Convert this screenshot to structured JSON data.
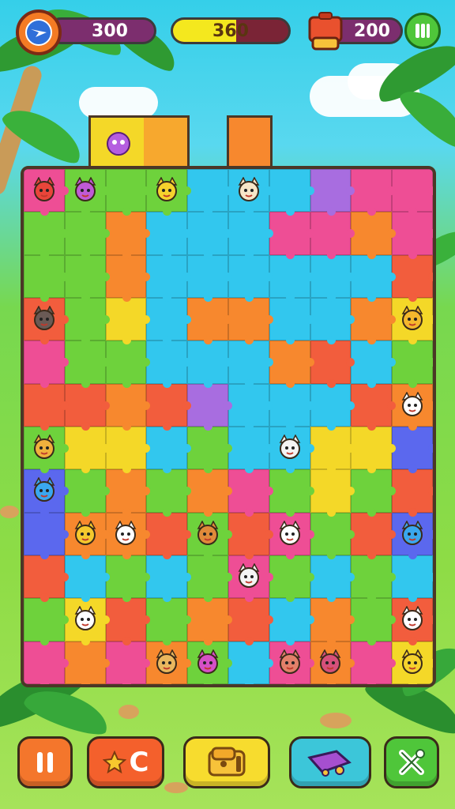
{
  "hud": {
    "coins": "300",
    "progress_value": "360",
    "progress_fraction": 0.55,
    "gems": "200"
  },
  "icons": {
    "coin_badge": "bird-emblem-icon",
    "gems_badge": "toolbox-icon",
    "menu_button": "pause-bars-icon"
  },
  "board": {
    "columns": 10,
    "rows": 12,
    "palette": {
      "o": "#f7882e",
      "y": "#f4d828",
      "g": "#6ed23c",
      "c": "#32c7ee",
      "p": "#ee4e95",
      "r": "#f25d3d",
      "v": "#a86de0",
      "b": "#5b68ee",
      "k": "#f0b13d"
    },
    "rows_layout": [
      "pgggcccvpp",
      "ggocccppop",
      "ggoccccccr",
      "rgycooccoy",
      "pggcccorcg",
      "rrorvcccro",
      "gyycgccyyb",
      "bgogopgygr",
      "boorgrpgrb",
      "rcgcgpgcgc",
      "gyrgorcogr",
      "popogcpopy"
    ],
    "critters": [
      {
        "row": 0,
        "col": 0,
        "name": "red-fox-critter",
        "color": "#e8453a"
      },
      {
        "row": 0,
        "col": 1,
        "name": "purple-orb-critter",
        "color": "#c05ad6"
      },
      {
        "row": 0,
        "col": 3,
        "name": "yellow-chick-critter",
        "color": "#f5d22d"
      },
      {
        "row": 0,
        "col": 5,
        "name": "blue-cat-critter",
        "color": "#f6e6c8"
      },
      {
        "row": 3,
        "col": 0,
        "name": "grey-mouse-critter",
        "color": "#6a5a55"
      },
      {
        "row": 3,
        "col": 9,
        "name": "yellow-lion-critter",
        "color": "#f5b82d"
      },
      {
        "row": 5,
        "col": 9,
        "name": "red-cat-critter",
        "color": "#ffffff"
      },
      {
        "row": 6,
        "col": 0,
        "name": "giraffe-critter",
        "color": "#f0b13d"
      },
      {
        "row": 6,
        "col": 6,
        "name": "blue-penguin-critter",
        "color": "#f4f4f4"
      },
      {
        "row": 7,
        "col": 0,
        "name": "blue-orb-critter",
        "color": "#3aa7ee"
      },
      {
        "row": 8,
        "col": 1,
        "name": "yellow-fox-critter",
        "color": "#f5c82d"
      },
      {
        "row": 8,
        "col": 2,
        "name": "red-bunny-critter",
        "color": "#ffffff"
      },
      {
        "row": 8,
        "col": 4,
        "name": "orange-squirrel-critter",
        "color": "#e08a3a"
      },
      {
        "row": 8,
        "col": 6,
        "name": "white-cat-critter",
        "color": "#ffffff"
      },
      {
        "row": 8,
        "col": 9,
        "name": "blue-bead-critter",
        "color": "#3aa7ee"
      },
      {
        "row": 9,
        "col": 5,
        "name": "white-ghost-critter",
        "color": "#f4f4f4"
      },
      {
        "row": 10,
        "col": 1,
        "name": "blue-fox-critter",
        "color": "#ffffff"
      },
      {
        "row": 10,
        "col": 9,
        "name": "red-wolf-critter",
        "color": "#ffffff"
      },
      {
        "row": 11,
        "col": 3,
        "name": "tan-dog-critter",
        "color": "#e9b75e"
      },
      {
        "row": 11,
        "col": 4,
        "name": "pink-orb-critter",
        "color": "#d650c6"
      },
      {
        "row": 11,
        "col": 6,
        "name": "monkey-critter",
        "color": "#e2806a"
      },
      {
        "row": 11,
        "col": 7,
        "name": "pink-cat-critter",
        "color": "#d6507a"
      },
      {
        "row": 11,
        "col": 9,
        "name": "yellow-cat-critter",
        "color": "#f5d22d"
      }
    ]
  },
  "bottom_bar": {
    "pause_icon": "pause-icon",
    "hint_label": "C",
    "hint_icon": "star-icon",
    "shop_icon": "treasure-chest-icon",
    "hammer_icon": "bulldozer-icon",
    "shuffle_icon": "crossed-tools-icon"
  },
  "colors": {
    "board_border": "#4b3726",
    "hud_pill": "#7c2e6e",
    "progress_fill": "#f4e81e"
  }
}
